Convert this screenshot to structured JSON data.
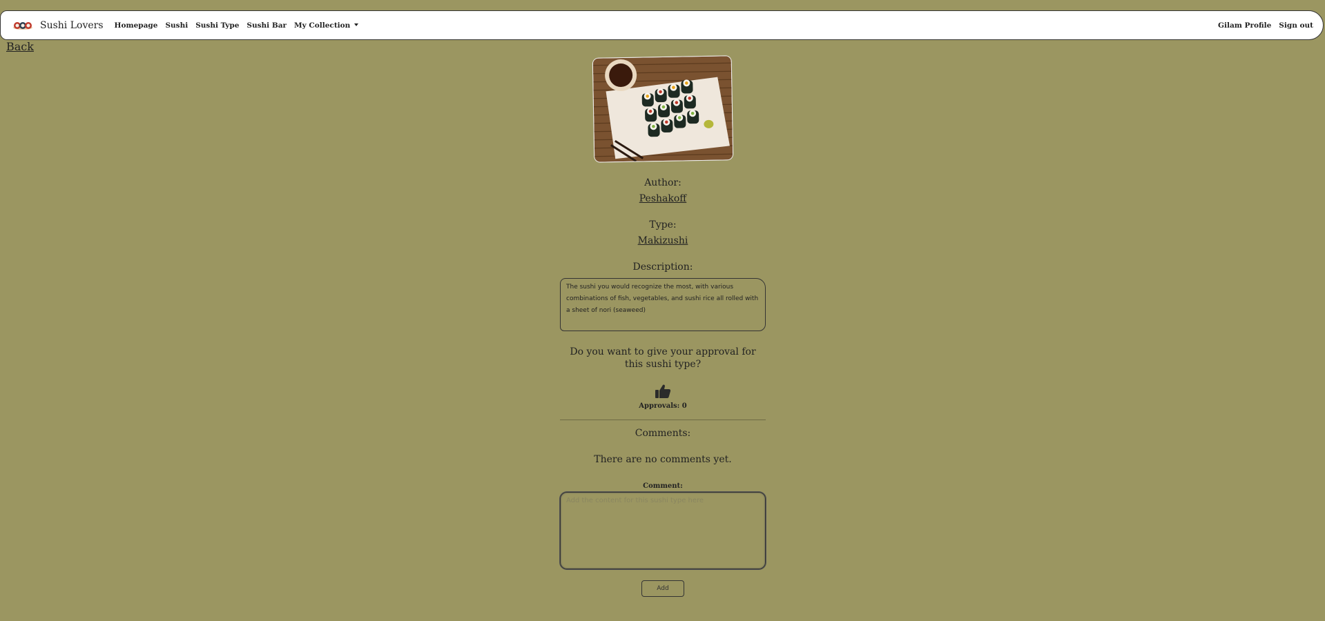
{
  "navbar": {
    "brand_name": "Sushi Lovers",
    "links": [
      "Homepage",
      "Sushi",
      "Sushi Type",
      "Sushi Bar",
      "My Collection"
    ],
    "right_links": [
      "Gilam Profile",
      "Sign out"
    ]
  },
  "back_label": "Back",
  "sushi": {
    "image_icon": "sushi-photo",
    "author_label": "Author:",
    "author": "Peshakoff",
    "type_label": "Type:",
    "type": "Makizushi",
    "description_label": "Description:",
    "description": "The sushi you would recognize the most, with various combinations of fish, vegetables, and sushi rice all rolled with a sheet of nori (seaweed)"
  },
  "approval": {
    "question": "Do you want to give your approval for this sushi type?",
    "icon": "thumbs-up-icon",
    "count_text": "Approvals: 0"
  },
  "comments": {
    "label": "Comments:",
    "empty_text": "There are no comments yet.",
    "form_label": "Comment:",
    "placeholder": "Add the content for this sushi type here",
    "value": "",
    "submit_label": "Add"
  },
  "colors": {
    "background": "#9b9661",
    "navbar": "#ffffff",
    "text": "#222222"
  }
}
